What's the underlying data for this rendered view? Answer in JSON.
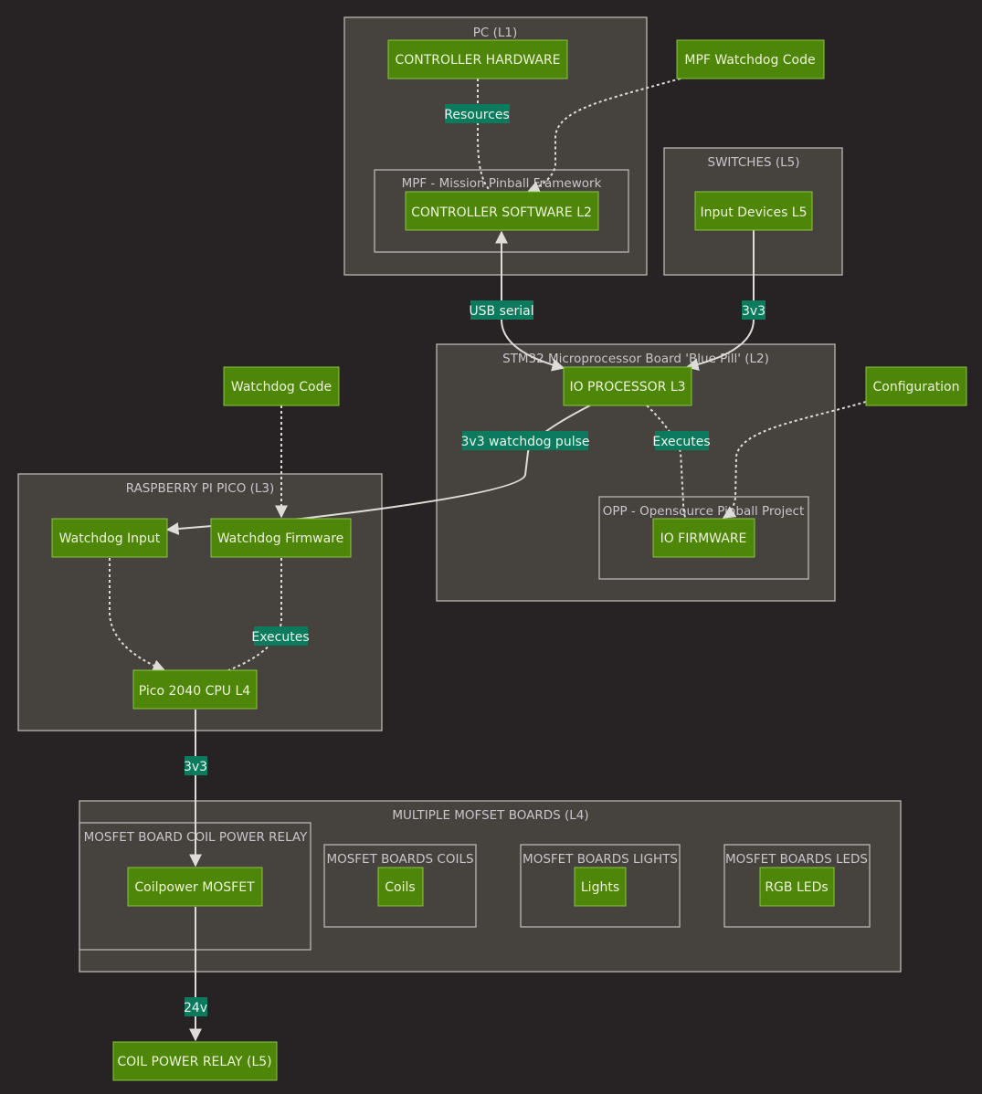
{
  "colors": {
    "background": "#272324",
    "cluster_fill": "#46423d",
    "cluster_stroke": "#b9b7b4",
    "node_fill": "#4e8609",
    "node_stroke": "#8ac43f",
    "edge_label_bg": "#0c7a5d",
    "edge": "#dedcd8"
  },
  "clusters": {
    "pc": "PC (L1)",
    "mpf": "MPF - Mission Pinball Framework",
    "switches": "SWITCHES (L5)",
    "stm32": "STM32 Microprocessor Board 'Blue Pill' (L2)",
    "opp": "OPP - Opensource Pinball Project",
    "pico": "RASPBERRY PI PICO (L3)",
    "mofset": "MULTIPLE MOFSET BOARDS (L4)",
    "relay_board": "MOSFET BOARD COIL POWER RELAY",
    "coils_board": "MOSFET BOARDS COILS",
    "lights_board": "MOSFET BOARDS LIGHTS",
    "leds_board": "MOSFET BOARDS LEDS"
  },
  "nodes": {
    "controller_hardware": "CONTROLLER HARDWARE",
    "mpf_watchdog_code": "MPF Watchdog Code",
    "controller_software": "CONTROLLER SOFTWARE L2",
    "input_devices": "Input Devices L5",
    "io_processor": "IO PROCESSOR L3",
    "watchdog_code": "Watchdog Code",
    "configuration": "Configuration",
    "io_firmware": "IO FIRMWARE",
    "watchdog_input": "Watchdog Input",
    "watchdog_firmware": "Watchdog Firmware",
    "pico_cpu": "Pico 2040 CPU L4",
    "coilpower_mosfet": "Coilpower MOSFET",
    "coils": "Coils",
    "lights": "Lights",
    "rgb_leds": "RGB LEDs",
    "coil_power_relay": "COIL POWER RELAY (L5)"
  },
  "edge_labels": {
    "resources": "Resources",
    "usb_serial": "USB serial",
    "switch_3v3": "3v3",
    "watchdog_pulse": "3v3 watchdog pulse",
    "executes_io": "Executes",
    "executes_pico": "Executes",
    "pico_3v3": "3v3",
    "relay_24v": "24v"
  }
}
